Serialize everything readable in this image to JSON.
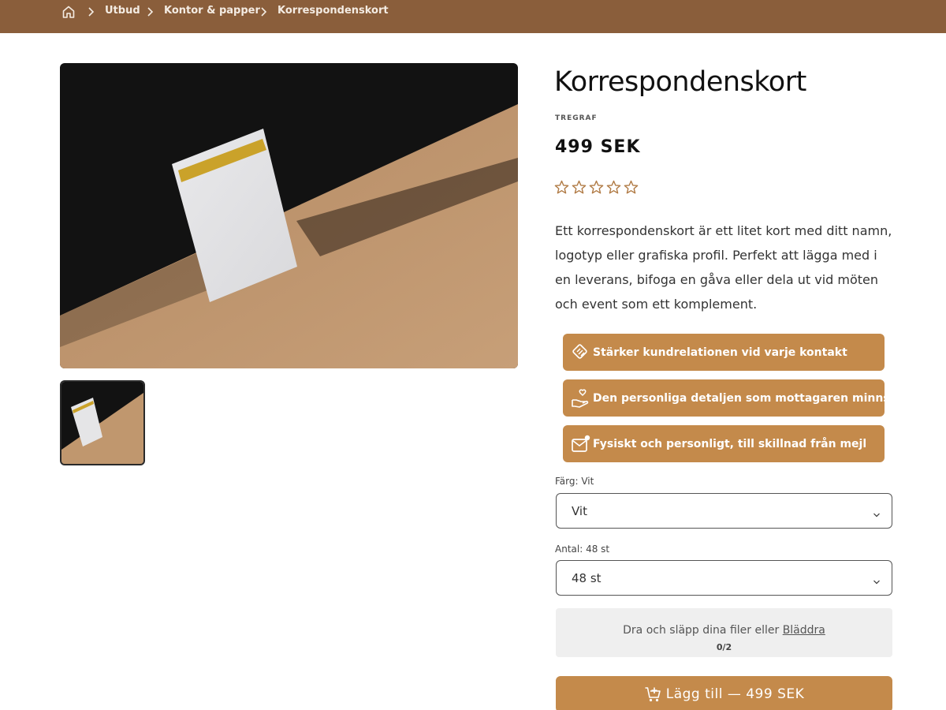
{
  "breadcrumb": {
    "home_icon": "home-icon",
    "items": [
      "Utbud",
      "Kontor & papper",
      "Korrespondenskort"
    ]
  },
  "product": {
    "title": "Korrespondenskort",
    "vendor": "TREGRAF",
    "price": "499 SEK",
    "rating": 0,
    "rating_max": 5,
    "description": "Ett korrespondenskort är ett litet kort med ditt namn, logotyp eller grafiska profil. Perfekt att lägga med i en leverans, bifoga en gåva eller dela ut vid möten och event som ett komplement."
  },
  "benefits": [
    {
      "icon": "handshake-icon",
      "text": "Stärker kundrelationen vid varje kontakt"
    },
    {
      "icon": "hand-heart-icon",
      "text": "Den personliga detaljen som mottagaren minns"
    },
    {
      "icon": "mail-icon",
      "text": "Fysiskt och personligt, till skillnad från mejl"
    }
  ],
  "color_option": {
    "label": "Färg: Vit",
    "selected": "Vit"
  },
  "quantity_option": {
    "label": "Antal: 48 st",
    "selected": "48 st"
  },
  "upload": {
    "text": "Dra och släpp dina filer eller",
    "link": "Bläddra",
    "count": "0/2"
  },
  "add_to_cart": {
    "label": "Lägg till — 499 SEK",
    "icon": "cart-plus-icon"
  },
  "colors": {
    "header": "#8a5e3b",
    "accent": "#c48a4b",
    "star": "#b07a44"
  }
}
